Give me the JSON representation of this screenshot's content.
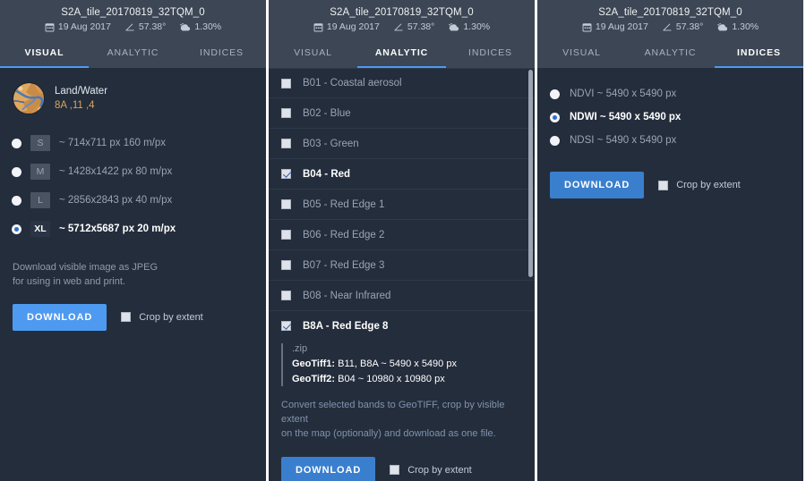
{
  "header": {
    "title": "S2A_tile_20170819_32TQM_0",
    "date": "19 Aug 2017",
    "angle": "57.38°",
    "cloud": "1.30%",
    "date_icon": "calendar-icon",
    "angle_icon": "angle-icon",
    "cloud_icon": "cloud-icon"
  },
  "tabs": [
    {
      "label": "VISUAL"
    },
    {
      "label": "ANALYTIC"
    },
    {
      "label": "INDICES"
    }
  ],
  "panel_visual": {
    "active_tab": "VISUAL",
    "preview": {
      "name": "Land/Water",
      "bands": "8A ,11 ,4"
    },
    "resolutions": [
      {
        "chip": "S",
        "label": "~ 714x711 px 160 m/px",
        "selected": false
      },
      {
        "chip": "M",
        "label": "~ 1428x1422 px 80 m/px",
        "selected": false
      },
      {
        "chip": "L",
        "label": "~ 2856x2843 px 40 m/px",
        "selected": false
      },
      {
        "chip": "XL",
        "label": "~ 5712x5687 px 20 m/px",
        "selected": true
      }
    ],
    "hint_line1": "Download visible image as JPEG",
    "hint_line2": "for using in web and print.",
    "download_label": "DOWNLOAD",
    "crop_label": "Crop by extent",
    "crop_checked": false
  },
  "panel_analytic": {
    "active_tab": "ANALYTIC",
    "bands": [
      {
        "label": "B01 - Coastal aerosol",
        "checked": false
      },
      {
        "label": "B02 - Blue",
        "checked": false
      },
      {
        "label": "B03 - Green",
        "checked": false
      },
      {
        "label": "B04 - Red",
        "checked": true
      },
      {
        "label": "B05 - Red Edge 1",
        "checked": false
      },
      {
        "label": "B06 - Red Edge 2",
        "checked": false
      },
      {
        "label": "B07 - Red Edge 3",
        "checked": false
      },
      {
        "label": "B08 - Near Infrared",
        "checked": false
      },
      {
        "label": "B8A - Red Edge 8",
        "checked": true
      }
    ],
    "zip": {
      "title": ".zip",
      "files": [
        {
          "name": "GeoTiff1:",
          "detail": "B11, B8A ~ 5490 x 5490 px"
        },
        {
          "name": "GeoTiff2:",
          "detail": "B04 ~ 10980 x 10980 px"
        }
      ]
    },
    "convert_line1": "Convert selected bands to GeoTIFF, crop by visible extent",
    "convert_line2": "on the map (optionally) and download as one file.",
    "download_label": "DOWNLOAD",
    "crop_label": "Crop by extent",
    "crop_checked": false
  },
  "panel_indices": {
    "active_tab": "INDICES",
    "indices": [
      {
        "label": "NDVI ~ 5490 x 5490 px",
        "selected": false
      },
      {
        "label": "NDWI ~ 5490 x 5490 px",
        "selected": true
      },
      {
        "label": "NDSI ~ 5490 x 5490 px",
        "selected": false
      }
    ],
    "download_label": "DOWNLOAD",
    "crop_label": "Crop by extent",
    "crop_checked": false
  },
  "colors": {
    "panel_bg": "#242d3c",
    "header_bg": "#3d4654",
    "accent": "#4e9af1",
    "accent_dark": "#3a7fce",
    "band_text": "#d8a55b",
    "muted": "#9aa4b3"
  }
}
